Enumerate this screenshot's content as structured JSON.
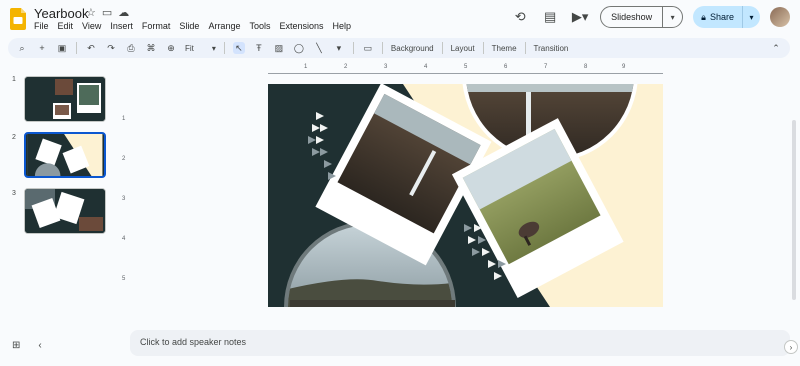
{
  "app": {
    "title": "Yearbook",
    "menus": [
      "File",
      "Edit",
      "View",
      "Insert",
      "Format",
      "Slide",
      "Arrange",
      "Tools",
      "Extensions",
      "Help"
    ]
  },
  "top_bar": {
    "slideshow_label": "Slideshow",
    "share_label": "Share"
  },
  "toolbar": {
    "zoom_value": "Fit",
    "background_label": "Background",
    "layout_label": "Layout",
    "theme_label": "Theme",
    "transition_label": "Transition"
  },
  "filmstrip": {
    "slides": [
      {
        "number": "1"
      },
      {
        "number": "2"
      },
      {
        "number": "3"
      }
    ],
    "selected_index": 2
  },
  "ruler": {
    "h_marks": [
      "1",
      "2",
      "3",
      "4",
      "5",
      "6",
      "7",
      "8",
      "9"
    ],
    "v_marks": [
      "1",
      "2",
      "3",
      "4",
      "5"
    ]
  },
  "notes": {
    "placeholder": "Click to add speaker notes"
  },
  "colors": {
    "accent": "#0b57d0",
    "share_bg": "#c2e7ff",
    "slide_dark": "#1f3032",
    "slide_cream": "#fdf2d3",
    "slides_yellow": "#f4b400"
  }
}
